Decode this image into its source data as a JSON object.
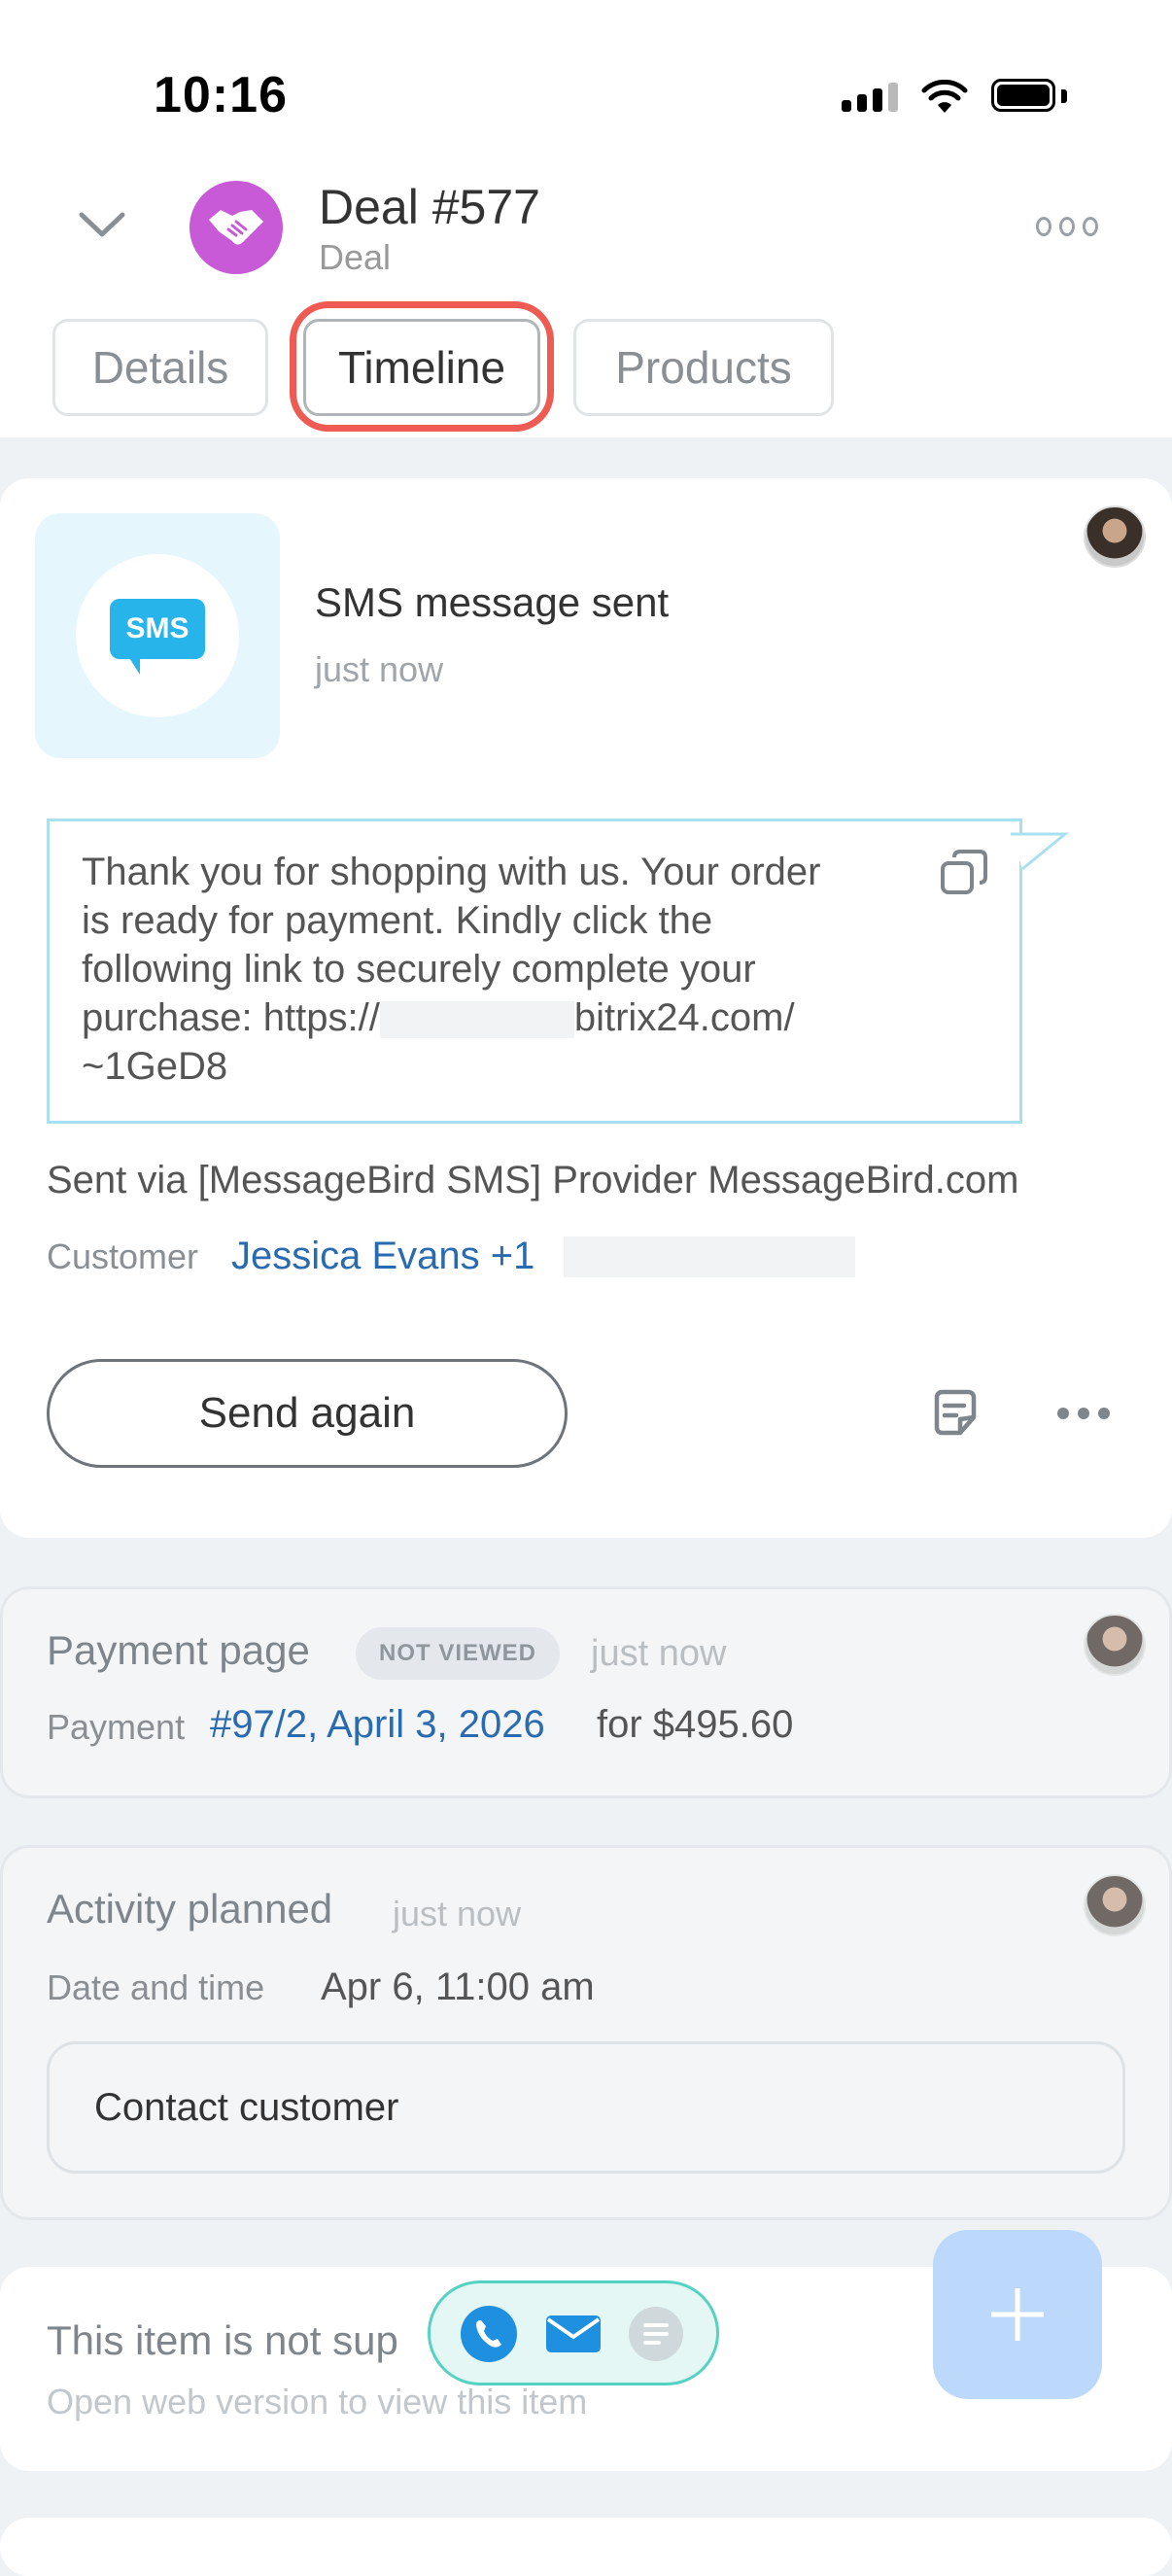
{
  "status_bar": {
    "time": "10:16"
  },
  "header": {
    "title": "Deal #577",
    "subtitle": "Deal",
    "tabs": [
      {
        "label": "Details"
      },
      {
        "label": "Timeline"
      },
      {
        "label": "Products"
      }
    ]
  },
  "sms_card": {
    "icon_label": "SMS",
    "title": "SMS message sent",
    "time": "just now",
    "message_line1": "Thank you for shopping with us. Your order",
    "message_line2": "is ready for payment. Kindly click the",
    "message_line3": "following link to securely complete your",
    "message_line4_a": "purchase: https://",
    "message_line4_b": "bitrix24.com/",
    "message_line5": "~1GeD8",
    "provider": "Sent via [MessageBird SMS] Provider MessageBird.com",
    "customer_label": "Customer",
    "customer_value": "Jessica Evans +1",
    "send_again": "Send again"
  },
  "payment_card": {
    "title": "Payment page",
    "badge": "NOT VIEWED",
    "time": "just now",
    "payment_label": "Payment",
    "payment_link": "#97/2, April 3, 2026",
    "payment_suffix": "for $495.60"
  },
  "activity_card": {
    "title": "Activity planned",
    "time": "just now",
    "date_label": "Date and time",
    "date_value": "Apr 6, 11:00 am",
    "task": "Contact customer"
  },
  "unsupported_card": {
    "title": "This item is not sup",
    "subtitle": "Open web version to view this item"
  },
  "colors": {
    "accent_blue": "#2a6bb0",
    "highlight_red": "#ef5a52",
    "sms_blue": "#27b4ea",
    "deal_purple": "#c85ad8",
    "fab_blue": "#bcd8fb"
  }
}
